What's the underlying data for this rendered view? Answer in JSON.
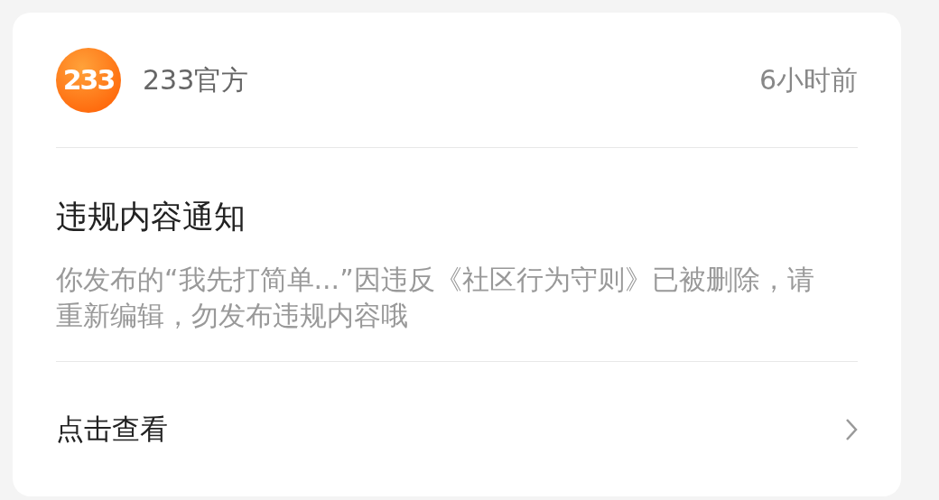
{
  "notice": {
    "sender": {
      "logo_text": "233",
      "name": "233官方"
    },
    "time": "6小时前",
    "title": "违规内容通知",
    "body": "你发布的“我先打简单...”因违反《社区行为守则》已被删除，请重新编辑，勿发布违规内容哦",
    "action": "点击查看"
  }
}
